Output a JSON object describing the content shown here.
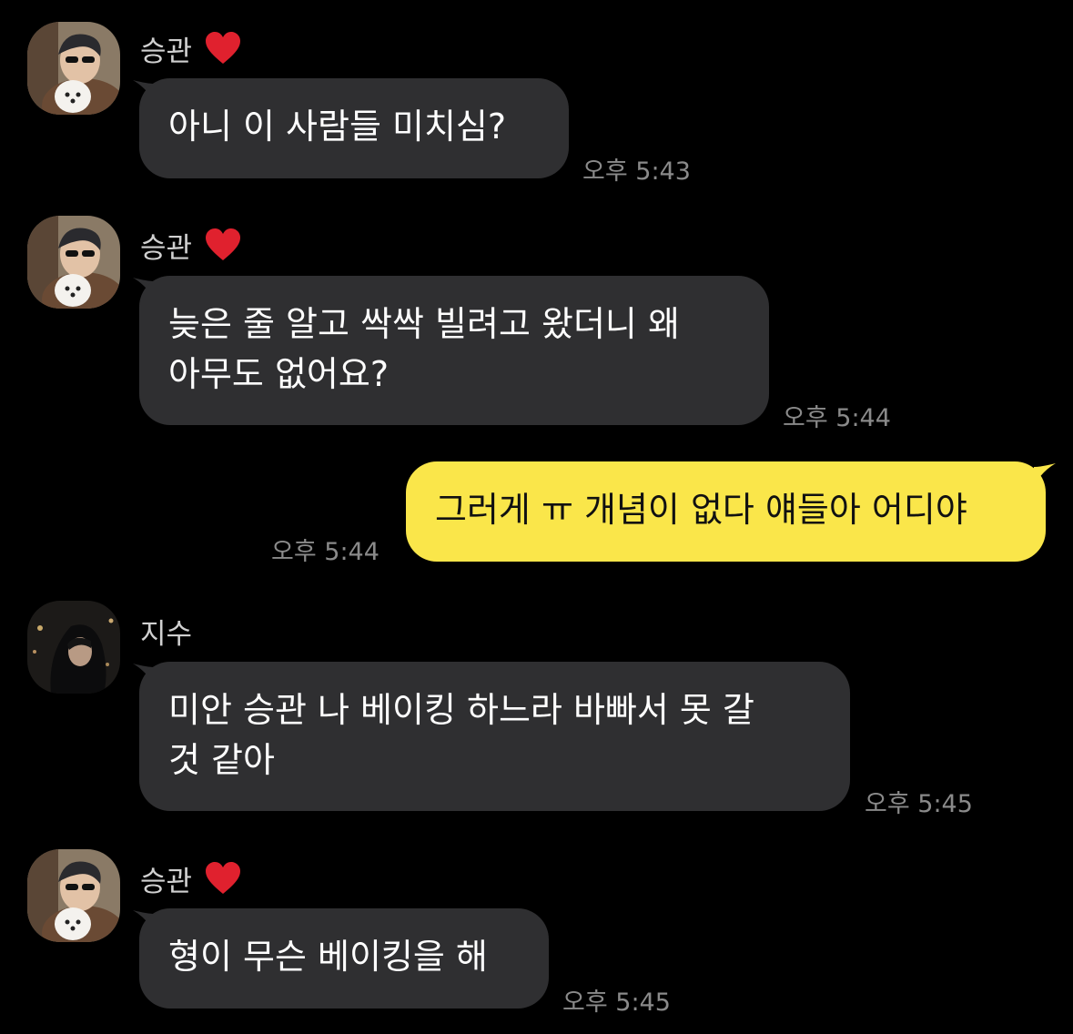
{
  "messages": [
    {
      "sender": "승관",
      "heart": "❤️",
      "lines": [
        "아니 이 사람들 미치심?"
      ],
      "time": "오후 5:43"
    },
    {
      "sender": "승관",
      "heart": "❤️",
      "lines": [
        "늦은 줄 알고 싹싹 빌려고 왔더니 왜",
        "아무도 없어요?"
      ],
      "time": "오후 5:44"
    },
    {
      "sender": "",
      "lines": [
        "그러게 ㅠ 개념이 없다 얘들아 어디야"
      ],
      "time": "오후 5:44"
    },
    {
      "sender": "지수",
      "lines": [
        "미안 승관 나 베이킹 하느라 바빠서 못 갈",
        "것 같아"
      ],
      "time": "오후 5:45"
    },
    {
      "sender": "승관",
      "heart": "❤️",
      "lines": [
        "형이 무슨 베이킹을 해"
      ],
      "time": "오후 5:45"
    }
  ],
  "colors": {
    "background": "#000000",
    "incoming_bubble": "#2f2f31",
    "outgoing_bubble": "#fae64a",
    "timestamp": "#8a8a8a"
  }
}
